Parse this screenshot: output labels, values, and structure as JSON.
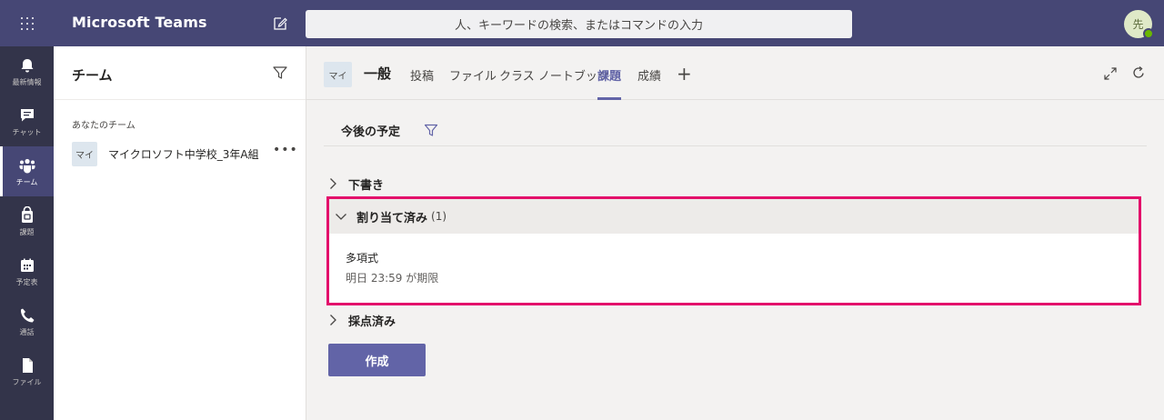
{
  "app": {
    "title": "Microsoft Teams"
  },
  "search": {
    "placeholder": "人、キーワードの検索、またはコマンドの入力"
  },
  "user": {
    "avatar_initial": "先"
  },
  "rail": {
    "items": [
      {
        "label": "最新情報",
        "icon": "bell-icon"
      },
      {
        "label": "チャット",
        "icon": "chat-icon"
      },
      {
        "label": "チーム",
        "icon": "teams-icon",
        "active": true
      },
      {
        "label": "課題",
        "icon": "assignments-icon"
      },
      {
        "label": "予定表",
        "icon": "calendar-icon"
      },
      {
        "label": "通話",
        "icon": "phone-icon"
      },
      {
        "label": "ファイル",
        "icon": "file-icon"
      }
    ]
  },
  "panel": {
    "title": "チーム",
    "section_label": "あなたのチーム",
    "teams": [
      {
        "tile": "マイ",
        "name": "マイクロソフト中学校_3年A組",
        "more": "•••"
      }
    ]
  },
  "channel": {
    "tile": "マイ",
    "name": "一般",
    "tabs": [
      {
        "label": "投稿"
      },
      {
        "label": "ファイル"
      },
      {
        "label": "クラス ノートブック"
      },
      {
        "label": "課題",
        "active": true
      },
      {
        "label": "成績"
      }
    ],
    "add_tab": "+"
  },
  "assignments": {
    "heading": "今後の予定",
    "sections": {
      "drafts": {
        "label": "下書き",
        "expanded": false
      },
      "assigned": {
        "label": "割り当て済み",
        "count": "(1)",
        "expanded": true
      },
      "graded": {
        "label": "採点済み",
        "expanded": false
      }
    },
    "items": [
      {
        "title": "多項式",
        "due": "明日 23:59 が期限"
      }
    ],
    "create_label": "作成"
  },
  "colors": {
    "topbar": "#464775",
    "rail": "#33344a",
    "accent": "#6264a7",
    "highlight": "#e3106b"
  }
}
